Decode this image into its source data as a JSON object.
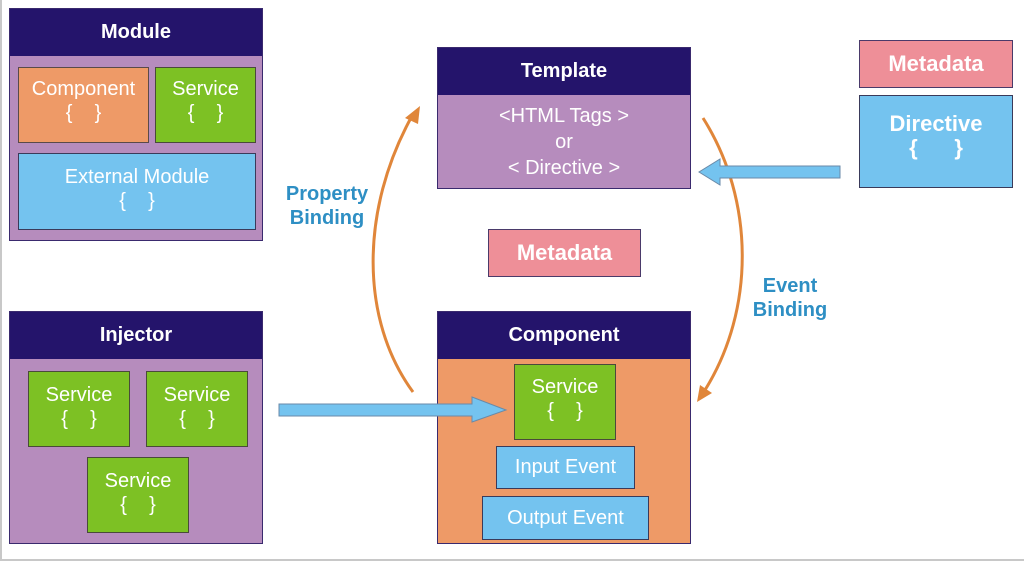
{
  "module": {
    "title": "Module",
    "component": {
      "label": "Component",
      "braces": "{    }"
    },
    "service": {
      "label": "Service",
      "braces": "{    }"
    },
    "external_module": {
      "label": "External Module",
      "braces": "{    }"
    }
  },
  "template": {
    "title": "Template",
    "lines": [
      "<HTML Tags >",
      "or",
      "<  Directive  >"
    ]
  },
  "directive_group": {
    "metadata": "Metadata",
    "directive": {
      "label": "Directive",
      "braces": "{      }"
    }
  },
  "center_metadata": "Metadata",
  "property_binding": {
    "line1": "Property",
    "line2": "Binding"
  },
  "event_binding": {
    "line1": "Event",
    "line2": "Binding"
  },
  "injector": {
    "title": "Injector",
    "services": [
      {
        "label": "Service",
        "braces": "{    }"
      },
      {
        "label": "Service",
        "braces": "{    }"
      },
      {
        "label": "Service",
        "braces": "{    }"
      }
    ]
  },
  "component": {
    "title": "Component",
    "service": {
      "label": "Service",
      "braces": "{    }"
    },
    "input_event": "Input Event",
    "output_event": "Output Event"
  },
  "colors": {
    "header": "#24146b",
    "purple": "#b68cbd",
    "orange": "#ee9a67",
    "green": "#7dc124",
    "blue": "#74c3ef",
    "pink": "#ee8f98",
    "binding_arrow": "#e0863a",
    "binding_text": "#2e8fc4"
  }
}
